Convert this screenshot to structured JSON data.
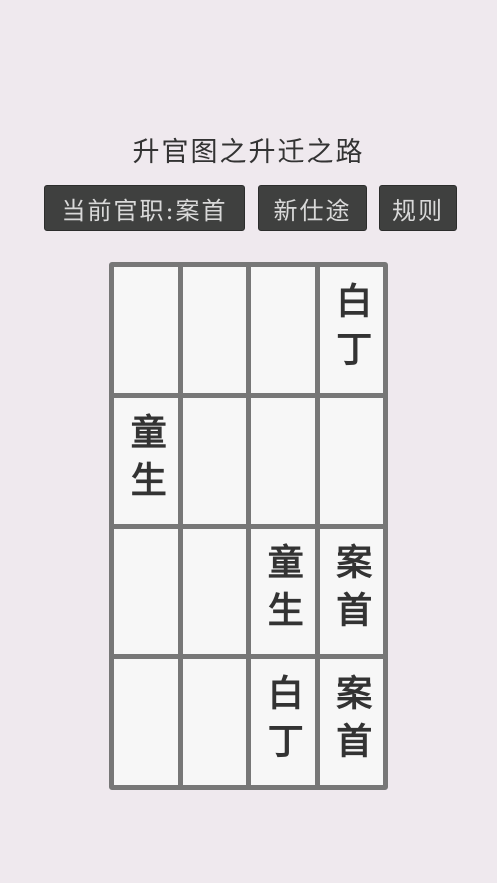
{
  "title": "升官图之升迁之路",
  "buttons": {
    "status": "当前官职:案首",
    "new_game": "新仕途",
    "rules": "规则"
  },
  "board": {
    "rows": [
      [
        "",
        "",
        "",
        "白丁"
      ],
      [
        "童生",
        "",
        "",
        ""
      ],
      [
        "",
        "",
        "童生",
        "案首"
      ],
      [
        "",
        "",
        "白丁",
        "案首"
      ]
    ]
  }
}
